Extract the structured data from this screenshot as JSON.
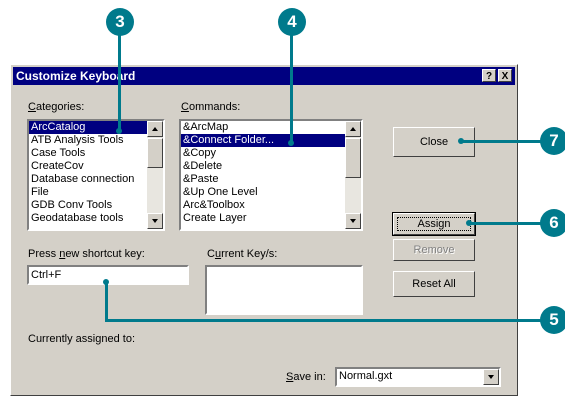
{
  "dialog": {
    "title": "Customize Keyboard",
    "help_button": "?",
    "close_button": "X"
  },
  "categories": {
    "label_prefix": "",
    "label_underlined": "C",
    "label_rest": "ategories:",
    "items": [
      {
        "label": "ArcCatalog",
        "selected": true
      },
      {
        "label": "ATB Analysis Tools",
        "selected": false
      },
      {
        "label": "Case Tools",
        "selected": false
      },
      {
        "label": "CreateCov",
        "selected": false
      },
      {
        "label": "Database connection",
        "selected": false
      },
      {
        "label": "File",
        "selected": false
      },
      {
        "label": "GDB Conv Tools",
        "selected": false
      },
      {
        "label": "Geodatabase tools",
        "selected": false
      }
    ]
  },
  "commands": {
    "label_prefix": "",
    "label_underlined": "C",
    "label_rest": "ommands:",
    "items": [
      {
        "label": "&ArcMap",
        "selected": false
      },
      {
        "label": "&Connect Folder...",
        "selected": true
      },
      {
        "label": "&Copy",
        "selected": false
      },
      {
        "label": "&Delete",
        "selected": false
      },
      {
        "label": "&Paste",
        "selected": false
      },
      {
        "label": "&Up One Level",
        "selected": false
      },
      {
        "label": "Arc&Toolbox",
        "selected": false
      },
      {
        "label": "Create Layer",
        "selected": false
      }
    ]
  },
  "shortcut": {
    "label_prefix": "Press ",
    "label_underlined": "n",
    "label_rest": "ew shortcut key:",
    "value": "Ctrl+F"
  },
  "current_keys": {
    "label_prefix": "C",
    "label_underlined": "u",
    "label_rest": "rrent Key/s:"
  },
  "assigned": {
    "label": "Currently assigned to:"
  },
  "save_in": {
    "label_underlined": "S",
    "label_rest": "ave in:",
    "value": "Normal.gxt"
  },
  "buttons": {
    "close": "Close",
    "assign": "Assign",
    "remove": "Remove",
    "reset_all": "Reset All"
  },
  "callouts": {
    "c3": "3",
    "c4": "4",
    "c5": "5",
    "c6": "6",
    "c7": "7"
  },
  "colors": {
    "callout": "#007a8c",
    "titlebar": "#000080",
    "selection": "#000080",
    "dialog_face": "#d4d0c8"
  }
}
